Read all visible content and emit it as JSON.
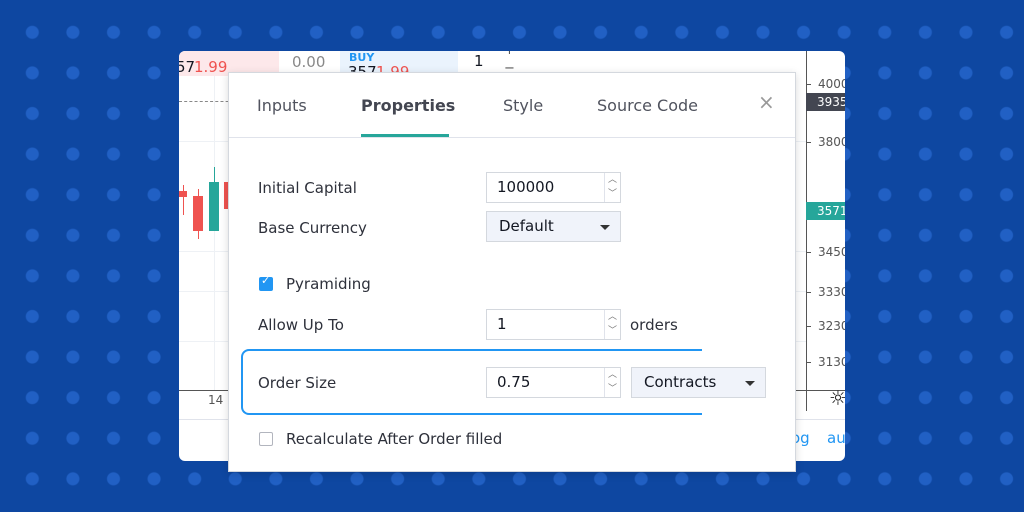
{
  "colors": {
    "background": "#0e47a1",
    "accent": "#2196f3",
    "tab_underline": "#26a69a",
    "up": "#26a69a",
    "down": "#ef5350"
  },
  "trade_bar": {
    "sell_price_prefix": "57",
    "sell_price_suffix": "1.99",
    "spread": "0.00",
    "buy_label": "BUY",
    "buy_price_prefix": "357",
    "buy_price_suffix": "1.99",
    "quantity": "1",
    "plus": "+",
    "minus": "−"
  },
  "price_axis": {
    "labels": [
      "4000",
      "3800",
      "3450",
      "3330",
      "3230",
      "3130"
    ],
    "current_marker": "3935",
    "last_price": "3571"
  },
  "time_axis": {
    "labels": [
      "14"
    ]
  },
  "footer_links": [
    "og",
    "au"
  ],
  "dialog": {
    "tabs": [
      {
        "label": "Inputs"
      },
      {
        "label": "Properties",
        "active": true
      },
      {
        "label": "Style"
      },
      {
        "label": "Source Code"
      }
    ],
    "close_icon": "×",
    "fields": {
      "initial_capital": {
        "label": "Initial Capital",
        "value": "100000"
      },
      "base_currency": {
        "label": "Base Currency",
        "value": "Default"
      },
      "pyramiding": {
        "label": "Pyramiding",
        "checked": true
      },
      "allow_up_to": {
        "label": "Allow Up To",
        "value": "1",
        "suffix": "orders"
      },
      "order_size": {
        "label": "Order Size",
        "value": "0.75",
        "unit": "Contracts"
      },
      "recalculate": {
        "label": "Recalculate After Order filled",
        "checked": false
      }
    }
  }
}
